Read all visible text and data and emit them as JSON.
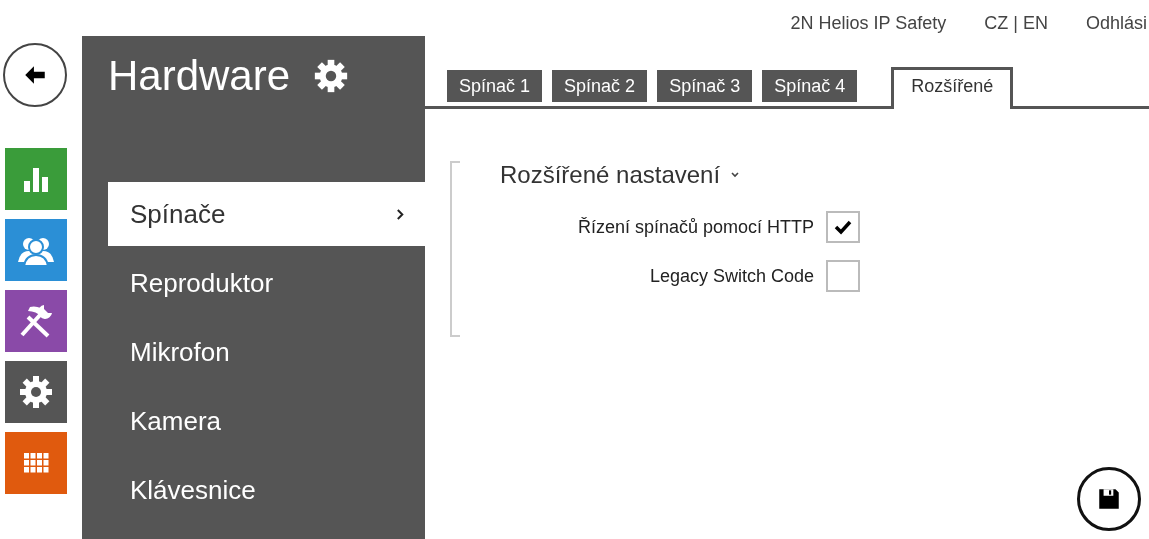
{
  "header": {
    "product": "2N Helios IP Safety",
    "language": "CZ | EN",
    "logout": "Odhlási"
  },
  "nav_tiles": [
    {
      "kind": "chart",
      "color": "#3a9c3a"
    },
    {
      "kind": "users",
      "color": "#2b8fd6"
    },
    {
      "kind": "tools",
      "color": "#8a4aa8"
    },
    {
      "kind": "settings",
      "color": "#555555"
    },
    {
      "kind": "grid",
      "color": "#e05a0e"
    }
  ],
  "sidebar": {
    "title": "Hardware",
    "items": [
      {
        "label": "Spínače",
        "selected": true
      },
      {
        "label": "Reproduktor",
        "selected": false
      },
      {
        "label": "Mikrofon",
        "selected": false
      },
      {
        "label": "Kamera",
        "selected": false
      },
      {
        "label": "Klávesnice",
        "selected": false
      }
    ]
  },
  "tabs": [
    {
      "label": "Spínač 1",
      "selected": false
    },
    {
      "label": "Spínač 2",
      "selected": false
    },
    {
      "label": "Spínač 3",
      "selected": false
    },
    {
      "label": "Spínač 4",
      "selected": false
    },
    {
      "label": "Rozšířené",
      "selected": true
    }
  ],
  "section": {
    "title": "Rozšířené nastavení",
    "expanded": true,
    "settings": [
      {
        "label": "Řízení spínačů pomocí HTTP",
        "checked": true
      },
      {
        "label": "Legacy Switch Code",
        "checked": false
      }
    ]
  }
}
